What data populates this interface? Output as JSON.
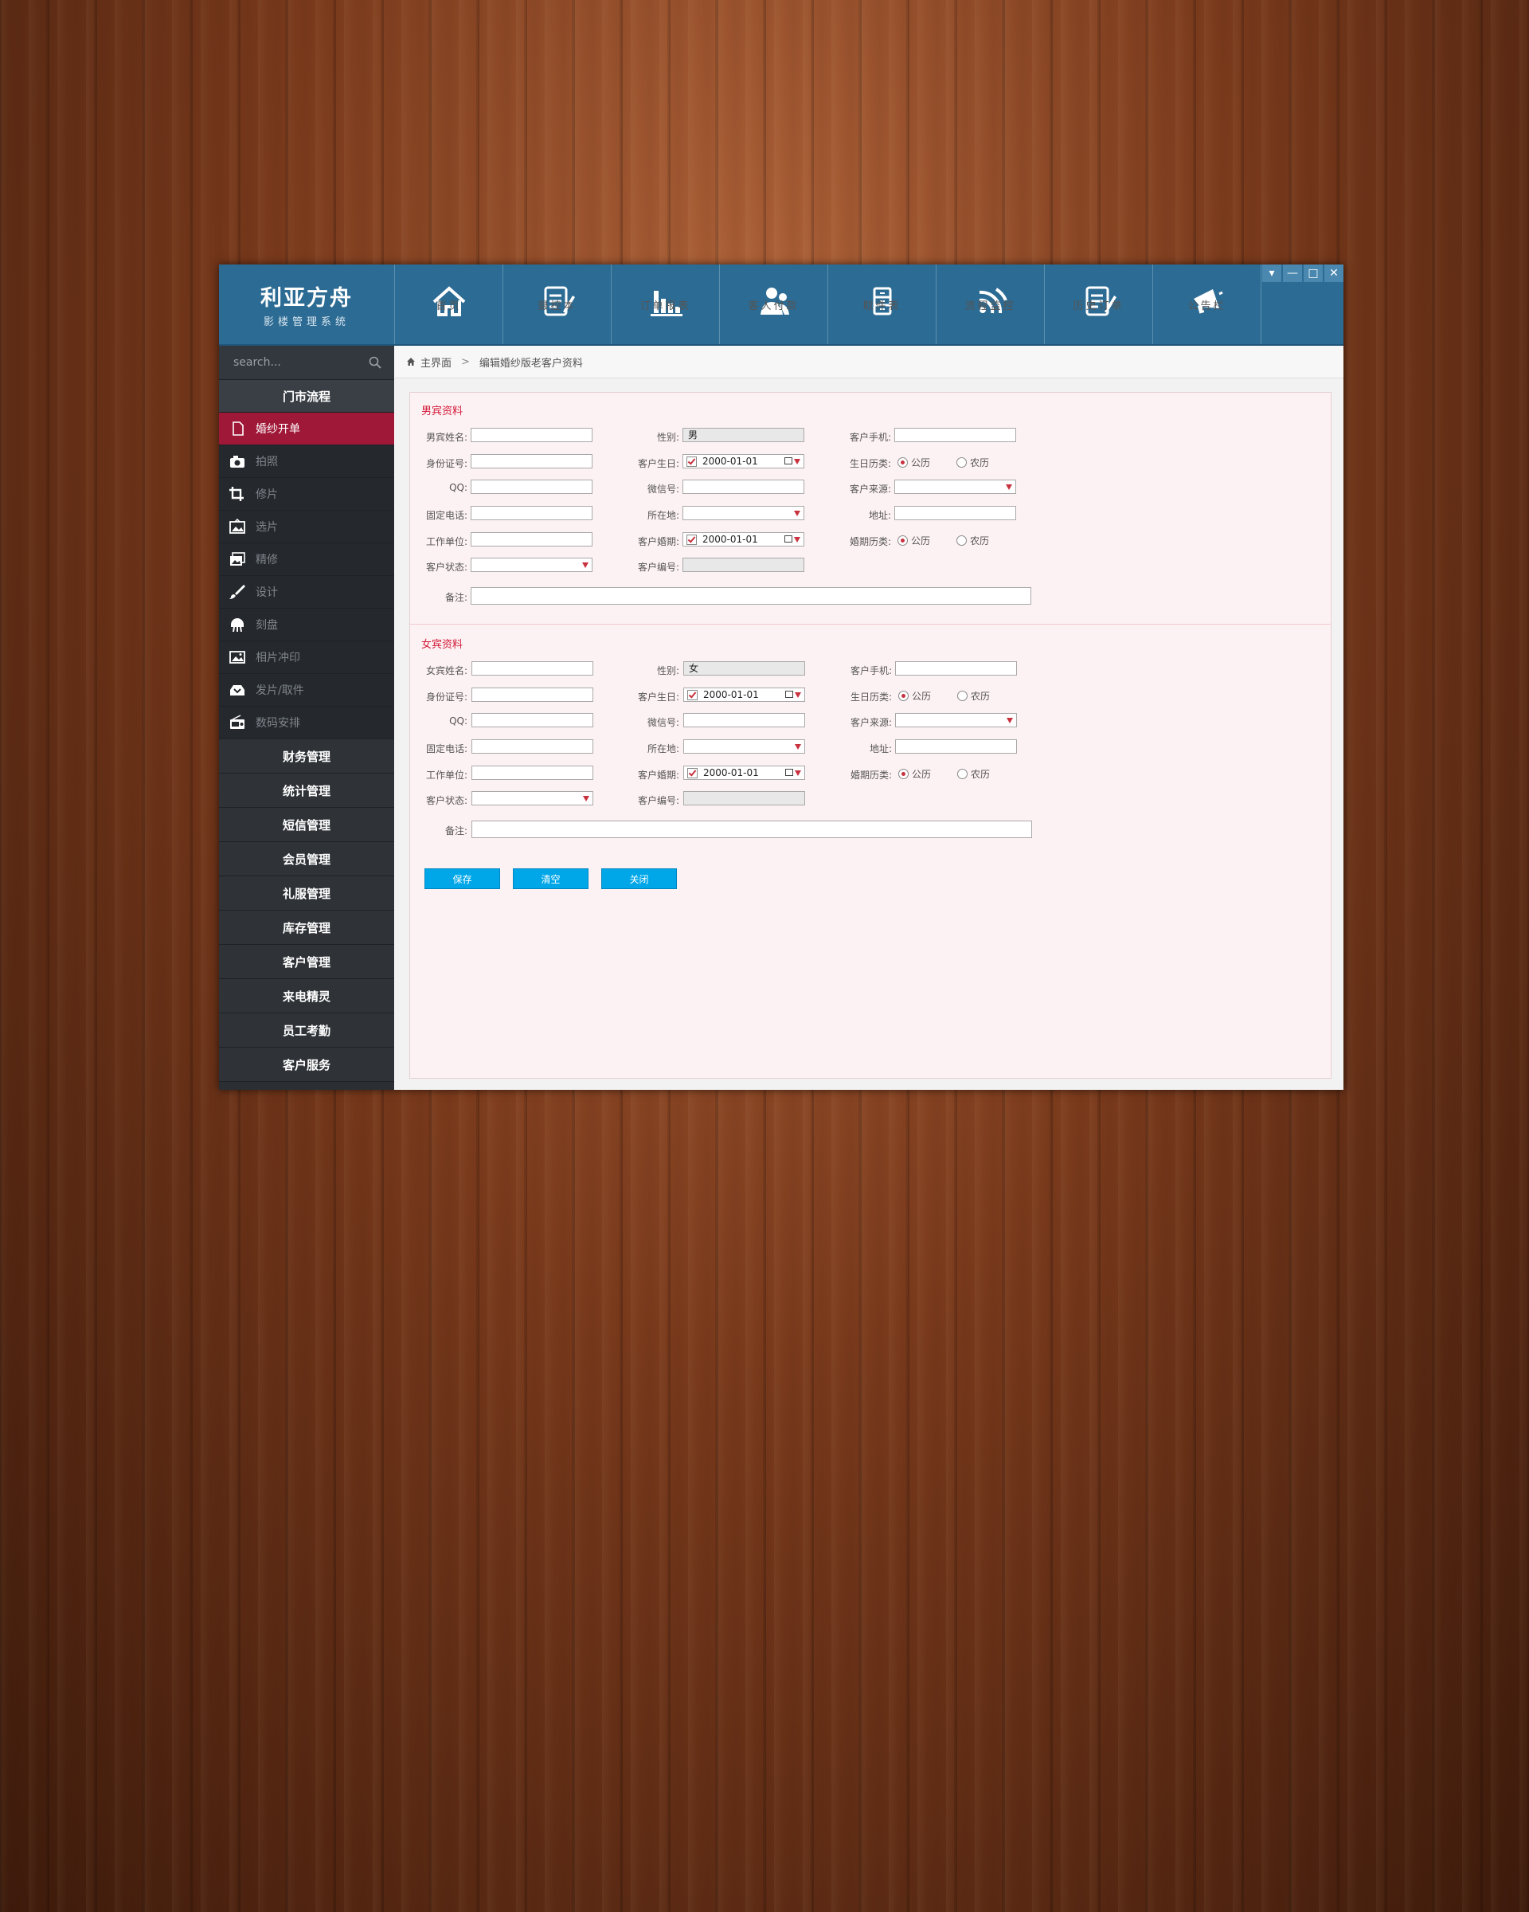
{
  "app": {
    "logo_title": "利亚方舟",
    "logo_subtitle": "影楼管理系统",
    "nav": [
      "首页",
      "摄控本",
      "订单报表",
      "客人付款",
      "取件表",
      "流程监控",
      "历史订单",
      "公告栏"
    ],
    "window_controls": [
      "▾",
      "—",
      "□",
      "✕"
    ]
  },
  "sidebar": {
    "search_placeholder": "search...",
    "section_title": "门市流程",
    "items": [
      "婚纱开单",
      "拍照",
      "修片",
      "选片",
      "精修",
      "设计",
      "刻盘",
      "相片冲印",
      "发片/取件",
      "数码安排"
    ],
    "active_item": "婚纱开单",
    "groups": [
      "财务管理",
      "统计管理",
      "短信管理",
      "会员管理",
      "礼服管理",
      "库存管理",
      "客户管理",
      "来电精灵",
      "员工考勤",
      "客户服务"
    ]
  },
  "breadcrumb": {
    "home": "主界面",
    "separator": ">",
    "current": "编辑婚纱版老客户资料"
  },
  "form": {
    "male": {
      "title": "男宾资料",
      "labels": {
        "name": "男宾姓名:",
        "gender": "性别:",
        "mobile": "客户手机:",
        "idcard": "身份证号:",
        "birthday": "客户生日:",
        "birthday_cal": "生日历类:",
        "qq": "QQ:",
        "wechat": "微信号:",
        "source": "客户来源:",
        "phone": "固定电话:",
        "location": "所在地:",
        "address": "地址:",
        "work": "工作单位:",
        "wedding": "客户婚期:",
        "wedding_cal": "婚期历类:",
        "status": "客户状态:",
        "code": "客户编号:",
        "remark": "备注:"
      },
      "values": {
        "gender": "男",
        "birthday": "2000-01-01",
        "wedding": "2000-01-01"
      }
    },
    "female": {
      "title": "女宾资料",
      "labels": {
        "name": "女宾姓名:",
        "gender": "性别:",
        "mobile": "客户手机:",
        "idcard": "身份证号:",
        "birthday": "客户生日:",
        "birthday_cal": "生日历类:",
        "qq": "QQ:",
        "wechat": "微信号:",
        "source": "客户来源:",
        "phone": "固定电话:",
        "location": "所在地:",
        "address": "地址:",
        "work": "工作单位:",
        "wedding": "客户婚期:",
        "wedding_cal": "婚期历类:",
        "status": "客户状态:",
        "code": "客户编号:",
        "remark": "备注:"
      },
      "values": {
        "gender": "女",
        "birthday": "2000-01-01",
        "wedding": "2000-01-01"
      }
    },
    "radio": {
      "solar": "公历",
      "lunar": "农历"
    },
    "buttons": {
      "save": "保存",
      "clear": "清空",
      "close": "关闭"
    }
  }
}
